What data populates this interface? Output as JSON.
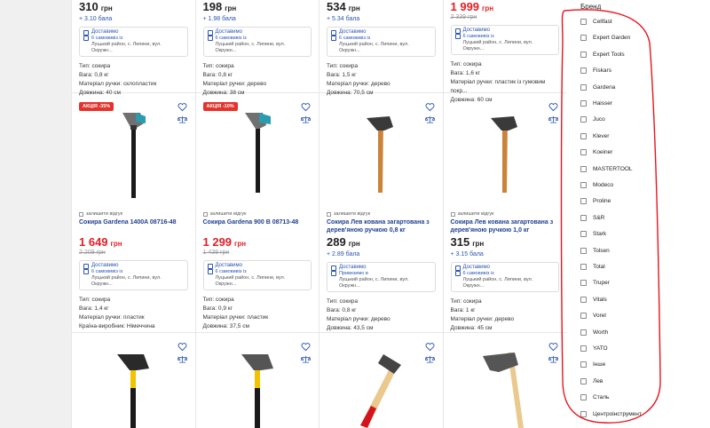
{
  "row1": [
    {
      "price": "310",
      "currency": "грн",
      "old": "",
      "bonus": "+ 3.10 бала",
      "delivery": "Доставимо",
      "pickup": "6 самовивіз із",
      "address": "Луцький район, с. Липини, вул. Окружн...",
      "specs": [
        "Тип: сокира",
        "Вага: 0,8 кг",
        "Матеріал ручки: склопластик",
        "Довжина: 40 см"
      ]
    },
    {
      "price": "198",
      "currency": "грн",
      "old": "",
      "bonus": "+ 1.98 бала",
      "delivery": "Доставимо",
      "pickup": "6 самовивіз із",
      "address": "Луцький район, с. Липини, вул. Окружн...",
      "specs": [
        "Тип: сокира",
        "Вага: 0,8 кг",
        "Матеріал ручки: дерево",
        "Довжина: 38 см"
      ]
    },
    {
      "price": "534",
      "currency": "грн",
      "old": "",
      "bonus": "+ 5.34 бала",
      "delivery": "Доставимо",
      "pickup": "6 самовивіз із",
      "address": "Луцький район, с. Липини, вул. Окружн...",
      "specs": [
        "Тип: сокира",
        "Вага: 1,5 кг",
        "Матеріал ручки: дерево",
        "Довжина: 70,5 см"
      ]
    },
    {
      "price": "1 999",
      "currency": "грн",
      "old": "2 339 грн",
      "bonus": "",
      "delivery": "Доставимо",
      "pickup": "6 самовивіз із",
      "address": "Луцький район, с. Липини, вул. Окружн...",
      "specs": [
        "Тип: сокира",
        "Вага: 1,6 кг",
        "Матеріал ручки: пластик із гумовим покр...",
        "Довжина: 60 см"
      ]
    }
  ],
  "row2": [
    {
      "badge": "АКЦІЯ -35%",
      "review": "залишити відгук",
      "title": "Сокира Gardena 1400A 08716-48",
      "price": "1 649",
      "currency": "грн",
      "old": "2 209 грн",
      "bonus": "",
      "delivery": "Доставимо",
      "pickup": "6 самовивіз із",
      "address": "Луцький район, с. Липини, вул. Окружн...",
      "specs": [
        "Тип: сокира",
        "Вага: 1,4 кг",
        "Матеріал ручки: пластик",
        "Країна-виробник: Німеччина"
      ]
    },
    {
      "badge": "АКЦІЯ -10%",
      "review": "залишити відгук",
      "title": "Сокира Gardena 900 B 08713-48",
      "price": "1 299",
      "currency": "грн",
      "old": "1 439 грн",
      "bonus": "",
      "delivery": "Доставимо",
      "pickup": "6 самовивіз із",
      "address": "Луцький район, с. Липини, вул. Окружн...",
      "specs": [
        "Тип: сокира",
        "Вага: 0,9 кг",
        "Матеріал ручки: пластик",
        "Довжина: 37,5 см"
      ]
    },
    {
      "badge": "",
      "review": "залишити відгук",
      "title": "Сокира Лев кована загартована з дерев'яною ручкою 0,8 кг",
      "price": "289",
      "currency": "грн",
      "old": "",
      "bonus": "+ 2.89 бала",
      "delivery": "Доставимо",
      "pickup": "Привезимо в",
      "address": "Луцький район, с. Липини, вул. Окружн...",
      "specs": [
        "Тип: сокира",
        "Вага: 0,8 кг",
        "Матеріал ручки: дерево",
        "Довжина: 43,5 см"
      ]
    },
    {
      "badge": "",
      "review": "залишити відгук",
      "title": "Сокира Лев кована загартована з дерев'яною ручкою 1,0 кг",
      "price": "315",
      "currency": "грн",
      "old": "",
      "bonus": "+ 3.15 бала",
      "delivery": "Доставимо",
      "pickup": "6 самовивіз із",
      "address": "Луцький район, с. Липини, вул. Окружн...",
      "specs": [
        "Тип: сокира",
        "Вага: 1 кг",
        "Матеріал ручки: дерево",
        "Довжина: 45 см"
      ]
    }
  ],
  "filter": {
    "title": "Бренд",
    "brands": [
      "Cellfast",
      "Expert Garden",
      "Expert Tools",
      "Fiskars",
      "Gardena",
      "Haisser",
      "Juco",
      "Klever",
      "Koeiner",
      "MASTERTOOL",
      "Modeco",
      "Proline",
      "S&R",
      "Stark",
      "Tolsen",
      "Total",
      "Truper",
      "Vitals",
      "Vorel",
      "Worth",
      "YATO",
      "Інше",
      "Лев",
      "Сталь",
      "Центроінструмент"
    ]
  },
  "colors": {
    "accent": "#2a55b4",
    "sale": "#e31e24",
    "outline": "#e8141c"
  }
}
